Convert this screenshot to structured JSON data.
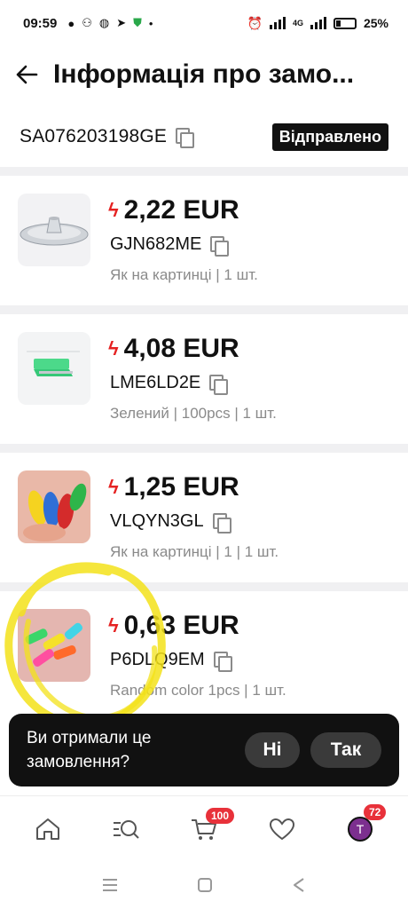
{
  "status_bar": {
    "time": "09:59",
    "network": "4G",
    "battery": "25%"
  },
  "header": {
    "title": "Інформація про замо..."
  },
  "order": {
    "id": "SA076203198GE",
    "status": "Відправлено"
  },
  "items": [
    {
      "price": "2,22 EUR",
      "sku": "GJN682ME",
      "variant": "Як на картинці | 1 шт.",
      "thumb_icon": "aluminum-tray-image"
    },
    {
      "price": "4,08 EUR",
      "sku": "LME6LD2E",
      "variant": "Зелений | 100pcs | 1 шт.",
      "thumb_icon": "green-clip-image"
    },
    {
      "price": "1,25 EUR",
      "sku": "VLQYN3GL",
      "variant": "Як на картинці | 1 | 1 шт.",
      "thumb_icon": "colorful-needle-threaders-image"
    },
    {
      "price": "0,63 EUR",
      "sku": "P6DLQ9EM",
      "variant": "Random color 1pcs | 1 шт.",
      "thumb_icon": "needle-threader-image"
    }
  ],
  "popup": {
    "question": "Ви отримали це замовлення?",
    "no_label": "Ні",
    "yes_label": "Так"
  },
  "bottom_nav": {
    "cart_badge": "100",
    "account_badge": "72",
    "avatar_letter": "T"
  },
  "colors": {
    "accent_red": "#e52222",
    "badge_red": "#e8313a",
    "annotation_yellow": "#f3e21a"
  }
}
